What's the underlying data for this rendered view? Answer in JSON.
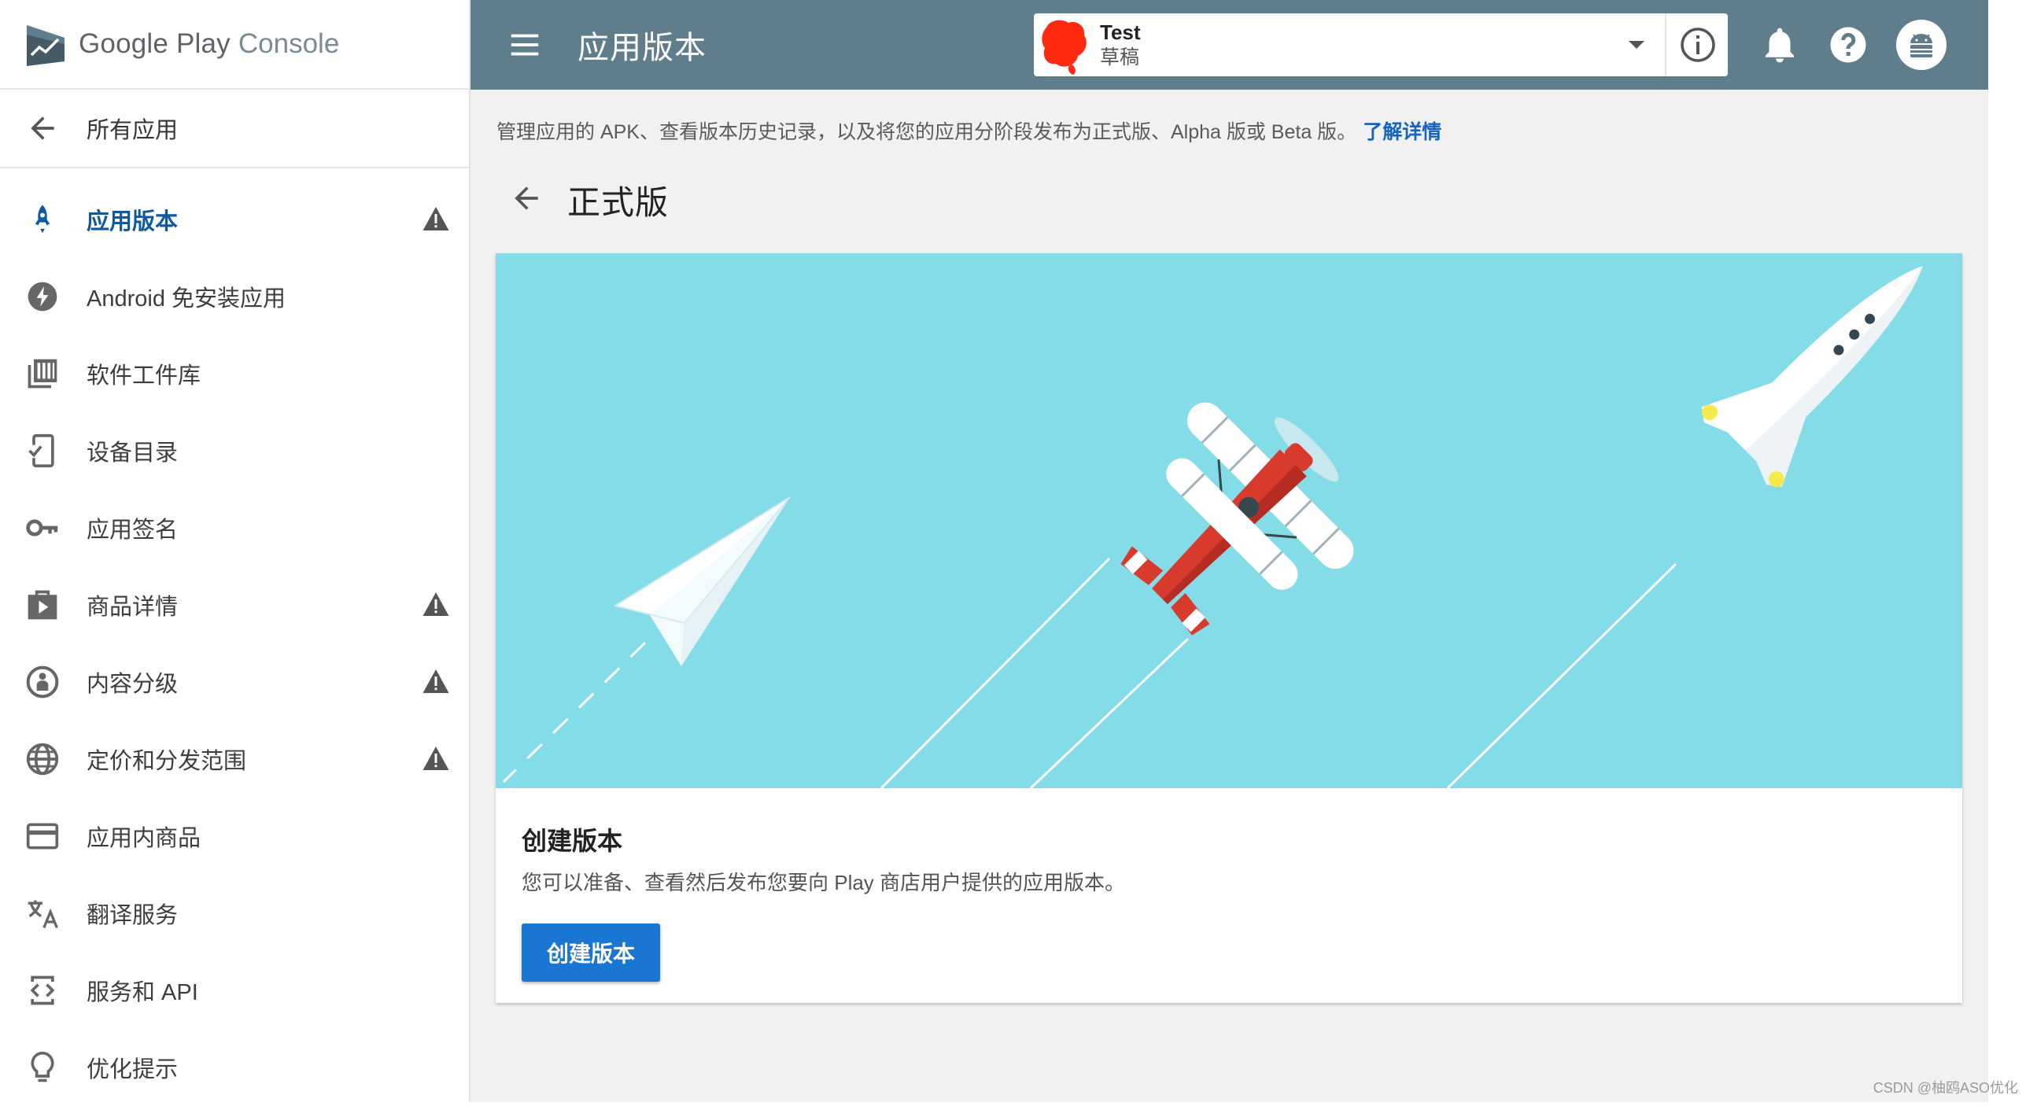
{
  "brand": {
    "google_play": "Google Play",
    "console": "Console"
  },
  "sidebar": {
    "back_label": "所有应用",
    "items": [
      {
        "label": "应用版本",
        "icon": "rocket-icon",
        "active": true,
        "warning": true
      },
      {
        "label": "Android 免安装应用",
        "icon": "bolt-icon",
        "active": false,
        "warning": false
      },
      {
        "label": "软件工件库",
        "icon": "library-icon",
        "active": false,
        "warning": false
      },
      {
        "label": "设备目录",
        "icon": "device-check-icon",
        "active": false,
        "warning": false
      },
      {
        "label": "应用签名",
        "icon": "key-icon",
        "active": false,
        "warning": false
      },
      {
        "label": "商品详情",
        "icon": "store-bag-icon",
        "active": false,
        "warning": true
      },
      {
        "label": "内容分级",
        "icon": "rating-icon",
        "active": false,
        "warning": true
      },
      {
        "label": "定价和分发范围",
        "icon": "globe-icon",
        "active": false,
        "warning": true
      },
      {
        "label": "应用内商品",
        "icon": "credit-card-icon",
        "active": false,
        "warning": false
      },
      {
        "label": "翻译服务",
        "icon": "translate-icon",
        "active": false,
        "warning": false
      },
      {
        "label": "服务和 API",
        "icon": "api-icon",
        "active": false,
        "warning": false
      },
      {
        "label": "优化提示",
        "icon": "lightbulb-icon",
        "active": false,
        "warning": false
      }
    ]
  },
  "topbar": {
    "title": "应用版本",
    "app_name": "Test",
    "app_state": "草稿"
  },
  "main": {
    "description": "管理应用的 APK、查看版本历史记录，以及将您的应用分阶段发布为正式版、Alpha 版或 Beta 版。",
    "learn_more": "了解详情",
    "section_title": "正式版",
    "card": {
      "title": "创建版本",
      "description": "您可以准备、查看然后发布您要向 Play 商店用户提供的应用版本。",
      "button_label": "创建版本"
    }
  },
  "watermark": "CSDN @柚鸥ASO优化",
  "colors": {
    "topbar": "#607d8b",
    "accent": "#1976d2",
    "active_nav": "#0f5a9e",
    "hero_bg": "#84dce8",
    "page_bg": "#f1f1f1"
  }
}
